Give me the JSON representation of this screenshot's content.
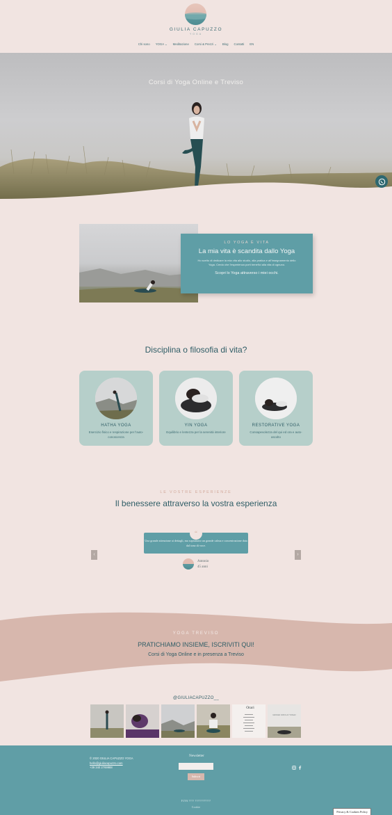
{
  "header": {
    "logo_name": "GIULIA CAPUZZO",
    "logo_sub": "YOGA",
    "nav": [
      "Chi sono",
      "YOGA ⌄",
      "Meditazione",
      "Corsi & Prezzi ⌄",
      "Blog",
      "Contatti",
      "EN"
    ]
  },
  "hero": {
    "title": "Corsi di Yoga Online e Treviso",
    "whatsapp_icon": "whatsapp-icon"
  },
  "intro": {
    "kicker": "LO YOGA È VITA",
    "heading": "La mia vita è scandita dallo Yoga",
    "text": "Ho scelto di dedicare la mia vita allo studio, alla pratica e all'insegnamento dello Yoga. Credo che l'esperienza porti benefici alla vita di ognuno.",
    "cta": "Scopri lo Yoga attraverso i miei occhi."
  },
  "disciplines": {
    "title": "Disciplina o filosofia di vita?",
    "cards": [
      {
        "title": "HATHA YOGA",
        "desc": "Esercizio fisico e respirazione per l'auto-conoscenza"
      },
      {
        "title": "YIN YOGA",
        "desc": "Equilibrio e lentezza per la serenità interiore"
      },
      {
        "title": "RESTORATIVE YOGA",
        "desc": "Consapevolezza del qui ed ora e auto-ascolto"
      }
    ]
  },
  "testimonials": {
    "kicker": "LE VOSTRE ESPERIENZE",
    "title": "Il benessere attraverso la vostra esperienza",
    "quote_mark": "“",
    "quote": "Una grande attenzione ai dettagli, ma soprattutto un grande calma e concentrazione data dal tono di voce.",
    "author": "Antonio",
    "age": "45 anni",
    "prev": "‹",
    "next": "›"
  },
  "band": {
    "kicker": "YOGA TREVISO",
    "title": "PRATICHIAMO INSIEME, ISCRIVITI QUI!",
    "subtitle": "Corsi di Yoga Online e in presenza a Treviso"
  },
  "instagram": {
    "handle": "@GIULIACAPUZZO__",
    "orari": "Orari",
    "orari_right": "GIOCHI CON LO YOGA!"
  },
  "footer": {
    "copyright": "© 2020 GIULIA CAPUZZO YOGA",
    "email": "hello@giuliacapuzzo.com",
    "phone": "+39 340 2769988",
    "newsletter_label": "Newsletter",
    "submit": "Subscri",
    "bottom_line1": "P.IVA ???? ????????????",
    "bottom_line2": "Cookie",
    "privacy": "Privacy & Cookies Policy"
  },
  "colors": {
    "background": "#f1e4e1",
    "teal": "#5f9ea6",
    "sage": "#b6cfca",
    "rose": "#d7b7ad",
    "text": "#2f5d66"
  }
}
